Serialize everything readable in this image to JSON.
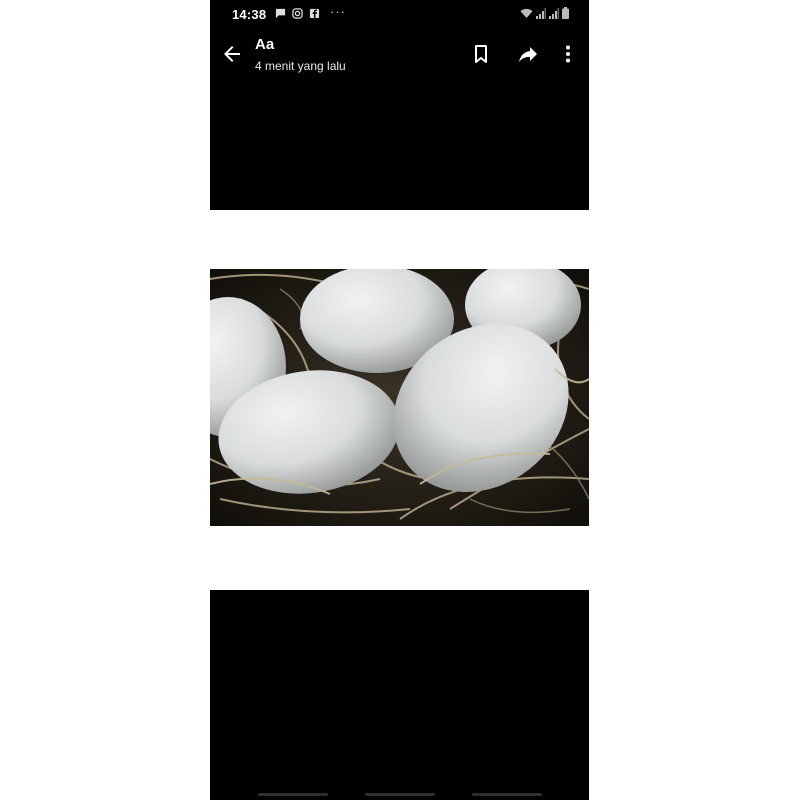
{
  "status_bar": {
    "time": "14:38",
    "notification_icons": [
      "message-icon",
      "instagram-icon",
      "facebook-icon"
    ],
    "overflow": "···",
    "right_icons": [
      "wifi-icon",
      "signal-icon",
      "signal-icon",
      "battery-icon"
    ]
  },
  "app_bar": {
    "title": "Aa",
    "subtitle": "4 menit yang lalu",
    "icons": [
      "back-arrow-icon",
      "bookmark-icon",
      "share-icon",
      "more-vert-icon"
    ]
  },
  "content": {
    "image_subject": "white eggs in straw nest"
  },
  "colors": {
    "background": "#000000",
    "page": "#ffffff",
    "text": "#ffffff"
  }
}
